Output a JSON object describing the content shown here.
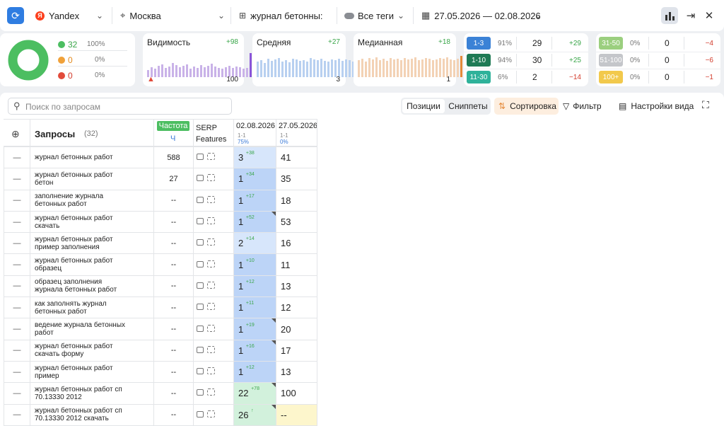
{
  "toolbar": {
    "engine": "Yandex",
    "region": "Москва",
    "project": "журнал бетонны:",
    "tags": "Все теги",
    "dates": "27.05.2026 — 02.08.2026"
  },
  "summary": {
    "up": {
      "count": "32",
      "pct": "100%"
    },
    "same": {
      "count": "0",
      "pct": "0%"
    },
    "down": {
      "count": "0",
      "pct": "0%"
    }
  },
  "metrics": [
    {
      "label": "Видимость",
      "delta": "+98",
      "value": "100",
      "color": "#c9b2e8",
      "last": "#8a54d8"
    },
    {
      "label": "Средняя",
      "delta": "+27",
      "value": "3",
      "color": "#b8d0f0",
      "last": "#3b7ad8"
    },
    {
      "label": "Медианная",
      "delta": "+18",
      "value": "1",
      "color": "#f3d2b5",
      "last": "#e58a3a"
    }
  ],
  "ranges": [
    {
      "label": "1-3",
      "pct": "91%",
      "count": "29",
      "delta": "+29",
      "color": "#3b82d6"
    },
    {
      "label": "1-10",
      "pct": "94%",
      "count": "30",
      "delta": "+25",
      "color": "#1f7a55"
    },
    {
      "label": "11-30",
      "pct": "6%",
      "count": "2",
      "delta": "−14",
      "color": "#2fb29a"
    },
    {
      "label": "31-50",
      "pct": "0%",
      "count": "0",
      "delta": "−4",
      "color": "#9bcf7f"
    },
    {
      "label": "51-100",
      "pct": "0%",
      "count": "0",
      "delta": "−6",
      "color": "#c4c6ca"
    },
    {
      "label": "100+",
      "pct": "0%",
      "count": "0",
      "delta": "−1",
      "color": "#f2c94c"
    }
  ],
  "controls": {
    "search_placeholder": "Поиск по запросам",
    "tab_positions": "Позиции",
    "tab_snippets": "Сниппеты",
    "sort": "Сортировка",
    "filter": "Фильтр",
    "view_settings": "Настройки вида"
  },
  "table": {
    "queries_header": "Запросы",
    "queries_count": "(32)",
    "freq_badge": "Частота",
    "freq_sub": "Ч",
    "serp_header": "SERP Features",
    "date1": "02.08.2026",
    "date1_range": "1-1",
    "date1_pct": "75%",
    "date2": "27.05.2026",
    "date2_range": "1-1",
    "date2_pct": "0%"
  },
  "rows": [
    {
      "q1": "журнал бетонных работ",
      "q2": "",
      "freq": "588",
      "p1": "3",
      "d1": "+38",
      "p2": "41",
      "bg1": "#d7e6fb",
      "bg2": "#fff",
      "tri": false
    },
    {
      "q1": "журнал бетонных работ",
      "q2": "бетон",
      "freq": "27",
      "p1": "1",
      "d1": "+34",
      "p2": "35",
      "bg1": "#bcd4f7",
      "bg2": "#fff",
      "tri": false
    },
    {
      "q1": "заполнение журнала",
      "q2": "бетонных работ",
      "freq": "--",
      "p1": "1",
      "d1": "+17",
      "p2": "18",
      "bg1": "#bcd4f7",
      "bg2": "#fff",
      "tri": false
    },
    {
      "q1": "журнал бетонных работ",
      "q2": "скачать",
      "freq": "--",
      "p1": "1",
      "d1": "+52",
      "p2": "53",
      "bg1": "#bcd4f7",
      "bg2": "#fff",
      "tri": true
    },
    {
      "q1": "журнал бетонных работ",
      "q2": "пример заполнения",
      "freq": "--",
      "p1": "2",
      "d1": "+14",
      "p2": "16",
      "bg1": "#d7e6fb",
      "bg2": "#fff",
      "tri": false
    },
    {
      "q1": "журнал бетонных работ",
      "q2": "образец",
      "freq": "--",
      "p1": "1",
      "d1": "+10",
      "p2": "11",
      "bg1": "#bcd4f7",
      "bg2": "#fff",
      "tri": false
    },
    {
      "q1": "образец заполнения",
      "q2": "журнала бетонных работ",
      "freq": "--",
      "p1": "1",
      "d1": "+12",
      "p2": "13",
      "bg1": "#bcd4f7",
      "bg2": "#fff",
      "tri": false
    },
    {
      "q1": "как заполнять журнал",
      "q2": "бетонных работ",
      "freq": "--",
      "p1": "1",
      "d1": "+11",
      "p2": "12",
      "bg1": "#bcd4f7",
      "bg2": "#fff",
      "tri": false
    },
    {
      "q1": "ведение журнала бетонных",
      "q2": "работ",
      "freq": "--",
      "p1": "1",
      "d1": "+19",
      "p2": "20",
      "bg1": "#bcd4f7",
      "bg2": "#fff",
      "tri": true
    },
    {
      "q1": "журнал бетонных работ",
      "q2": "скачать форму",
      "freq": "--",
      "p1": "1",
      "d1": "+16",
      "p2": "17",
      "bg1": "#bcd4f7",
      "bg2": "#fff",
      "tri": true
    },
    {
      "q1": "журнал бетонных работ",
      "q2": "пример",
      "freq": "--",
      "p1": "1",
      "d1": "+12",
      "p2": "13",
      "bg1": "#bcd4f7",
      "bg2": "#fff",
      "tri": false
    },
    {
      "q1": "журнал бетонных работ сп",
      "q2": "70.13330 2012",
      "freq": "--",
      "p1": "22",
      "d1": "+78",
      "p2": "100",
      "bg1": "#d2f1dc",
      "bg2": "#fff",
      "tri": true
    },
    {
      "q1": "журнал бетонных работ сп",
      "q2": "70.13330 2012 скачать",
      "freq": "--",
      "p1": "26",
      "d1": "↑",
      "p2": "--",
      "bg1": "#d2f1dc",
      "bg2": "#fdf6cc",
      "tri": true
    }
  ]
}
